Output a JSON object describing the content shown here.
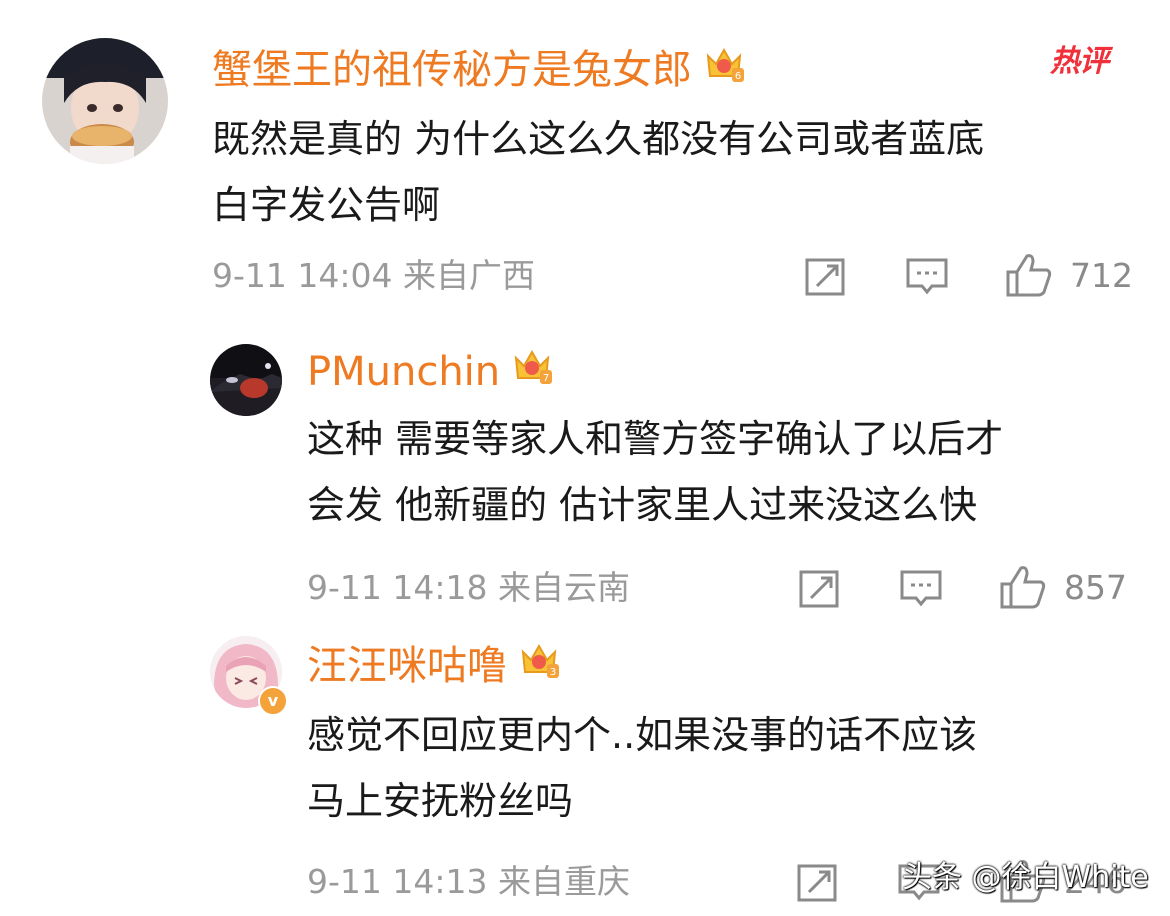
{
  "hot_badge": "热评",
  "watermark": "头条 @徐白White",
  "comments": [
    {
      "username": "蟹堡王的祖传秘方是兔女郎",
      "text_lines": [
        "既然是真的 为什么这么久都没有公司或者蓝底",
        "白字发公告啊"
      ],
      "meta": "9-11 14:04 来自广西",
      "likes": "712"
    },
    {
      "username": "PMunchin",
      "text_lines": [
        "这种 需要等家人和警方签字确认了以后才",
        "会发  他新疆的 估计家里人过来没这么快"
      ],
      "meta": "9-11 14:18 来自云南",
      "likes": "857"
    },
    {
      "username": "汪汪咪咕噜",
      "text_lines": [
        "感觉不回应更内个..如果没事的话不应该",
        "马上安抚粉丝吗"
      ],
      "meta": "9-11 14:13 来自重庆",
      "likes": "246"
    }
  ],
  "colors": {
    "username": "#ee7a22",
    "text": "#1a1a1a",
    "meta": "#9a9a9a",
    "hot_badge": "#f0303a"
  },
  "icons": [
    "crown-badge-icon",
    "repost-icon",
    "comment-icon",
    "like-icon"
  ]
}
